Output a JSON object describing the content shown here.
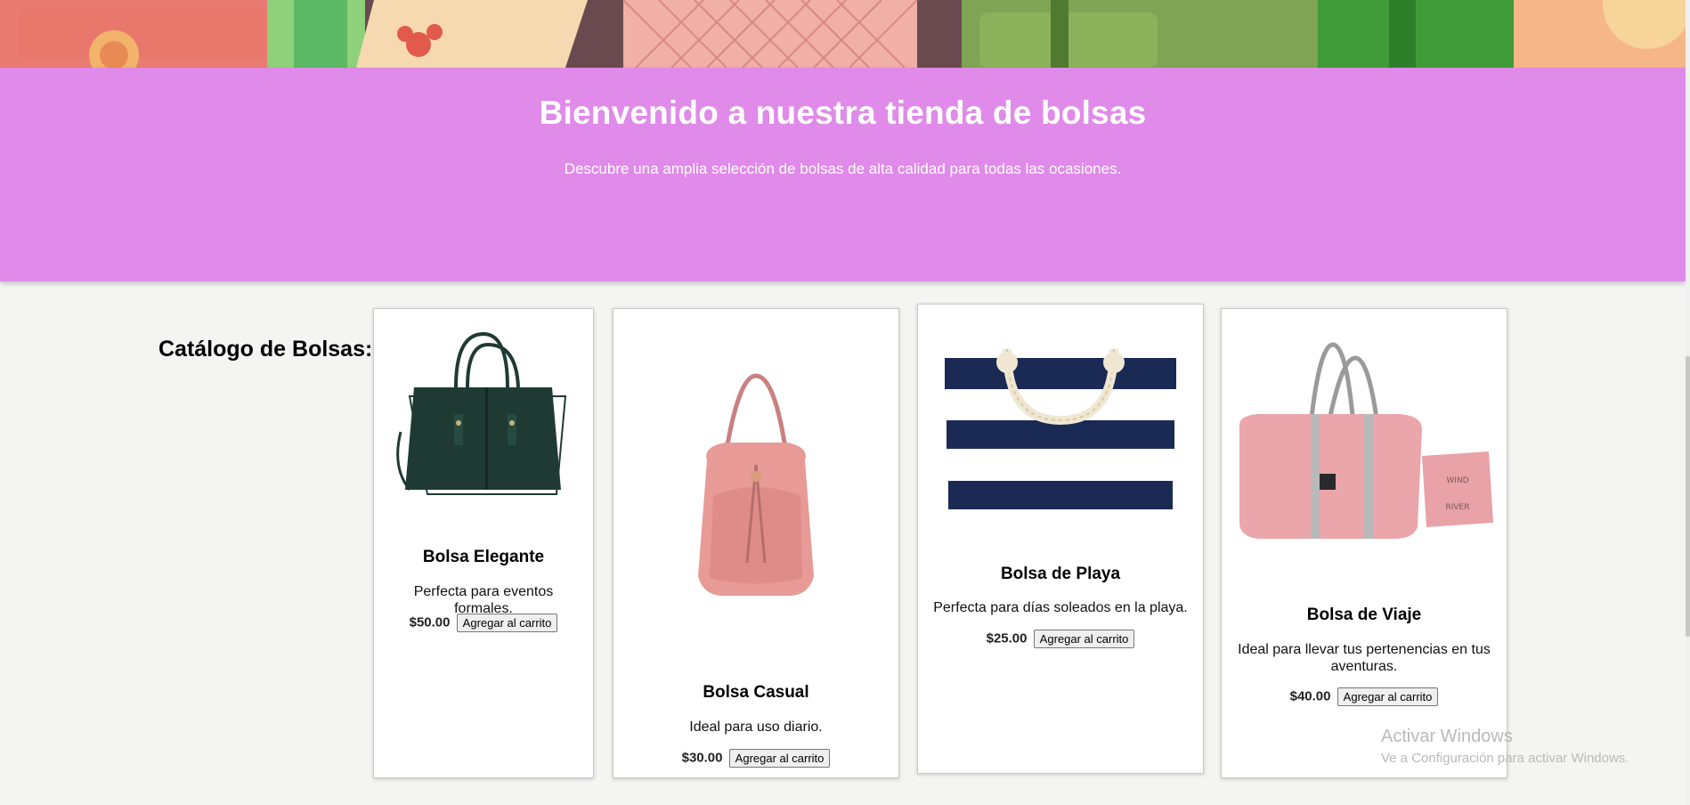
{
  "hero": {
    "title": "Bienvenido a nuestra tienda de bolsas",
    "subtitle": "Descubre una amplia selección de bolsas de alta calidad para todas las ocasiones."
  },
  "catalog": {
    "title": "Catálogo de Bolsas:",
    "products": [
      {
        "name": "Bolsa Elegante",
        "description": "Perfecta para eventos formales.",
        "price": "$50.00",
        "button": "Agregar al carrito",
        "image_icon": "dark-green-handbag-image"
      },
      {
        "name": "Bolsa Casual",
        "description": "Ideal para uso diario.",
        "price": "$30.00",
        "button": "Agregar al carrito",
        "image_icon": "pink-hobo-bag-image"
      },
      {
        "name": "Bolsa de Playa",
        "description": "Perfecta para días soleados en la playa.",
        "price": "$25.00",
        "button": "Agregar al carrito",
        "image_icon": "striped-beach-tote-image"
      },
      {
        "name": "Bolsa de Viaje",
        "description": "Ideal para llevar tus pertenencias en tus aventuras.",
        "price": "$40.00",
        "button": "Agregar al carrito",
        "image_icon": "pink-travel-bag-image"
      }
    ]
  },
  "watermark": {
    "line1": "Activar Windows",
    "line2": "Ve a Configuración para activar Windows."
  },
  "colors": {
    "hero_bg": "#e08ae9",
    "page_bg": "#f4f4f3",
    "card_bg": "#ffffff"
  }
}
